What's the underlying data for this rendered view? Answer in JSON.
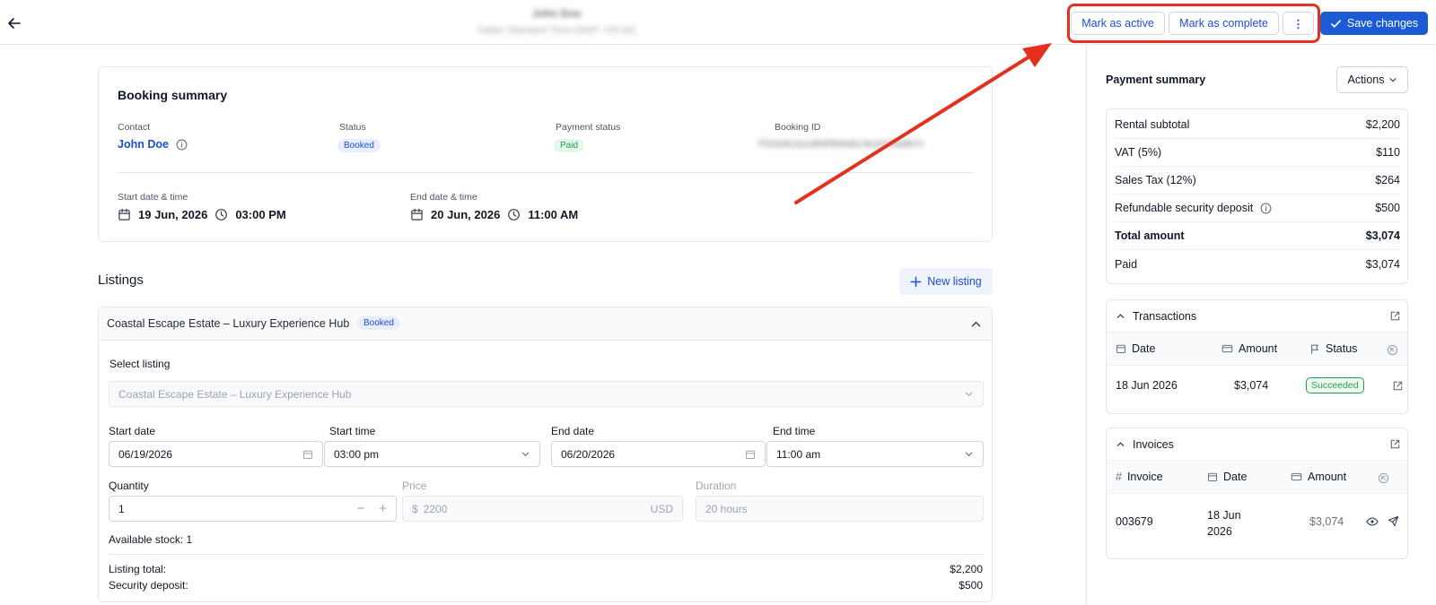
{
  "header": {
    "title": "John Doe",
    "subtitle": "Indian Standard Time (GMT +05:30)",
    "mark_active_label": "Mark as active",
    "mark_complete_label": "Mark as complete",
    "more_label": "⋮",
    "save_label": "Save changes"
  },
  "booking_summary": {
    "title": "Booking summary",
    "contact_label": "Contact",
    "contact_value": "John Doe",
    "status_label": "Status",
    "status_value": "Booked",
    "payment_status_label": "Payment status",
    "payment_status_value": "Paid",
    "booking_id_label": "Booking ID",
    "booking_id_value": "f7b3a9c2e1d84f5b9a6c3e2d1f0a8b7c",
    "start_label": "Start date & time",
    "start_date": "19 Jun, 2026",
    "start_time": "03:00 PM",
    "end_label": "End date & time",
    "end_date": "20 Jun, 2026",
    "end_time": "11:00 AM"
  },
  "listings": {
    "title": "Listings",
    "new_listing_label": "New listing",
    "item": {
      "name": "Coastal Escape Estate – Luxury Experience Hub",
      "badge": "Booked",
      "select_listing_label": "Select listing",
      "select_listing_value": "Coastal Escape Estate – Luxury Experience Hub",
      "start_date_label": "Start date",
      "start_date_value": "06/19/2026",
      "start_time_label": "Start time",
      "start_time_value": "03:00 pm",
      "end_date_label": "End date",
      "end_date_value": "06/20/2026",
      "end_time_label": "End time",
      "end_time_value": "11:00 am",
      "quantity_label": "Quantity",
      "quantity_value": "1",
      "price_label": "Price",
      "price_prefix": "$",
      "price_value": "2200",
      "price_currency": "USD",
      "duration_label": "Duration",
      "duration_value": "20 hours",
      "available_stock_label": "Available stock:",
      "available_stock_value": "1",
      "listing_total_label": "Listing total:",
      "listing_total_value": "$2,200",
      "security_deposit_label": "Security deposit:",
      "security_deposit_value": "$500"
    }
  },
  "payment_summary": {
    "title": "Payment summary",
    "actions_label": "Actions",
    "rows": [
      {
        "label": "Rental subtotal",
        "value": "$2,200"
      },
      {
        "label": "VAT (5%)",
        "value": "$110"
      },
      {
        "label": "Sales Tax (12%)",
        "value": "$264"
      },
      {
        "label": "Refundable security deposit",
        "value": "$500"
      },
      {
        "label": "Total amount",
        "value": "$3,074"
      },
      {
        "label": "Paid",
        "value": "$3,074"
      }
    ]
  },
  "transactions": {
    "title": "Transactions",
    "col_date": "Date",
    "col_amount": "Amount",
    "col_status": "Status",
    "row": {
      "date": "18 Jun 2026",
      "amount": "$3,074",
      "status": "Succeeded"
    }
  },
  "invoices": {
    "title": "Invoices",
    "col_invoice": "Invoice",
    "col_date": "Date",
    "col_amount": "Amount",
    "row": {
      "invoice": "003679",
      "date_line1": "18 Jun",
      "date_line2": "2026",
      "amount": "$3,074"
    }
  },
  "colors": {
    "accent": "#1d5bd6",
    "link": "#1d4ed8",
    "success": "#16a34a",
    "annotation": "#e5301e"
  }
}
